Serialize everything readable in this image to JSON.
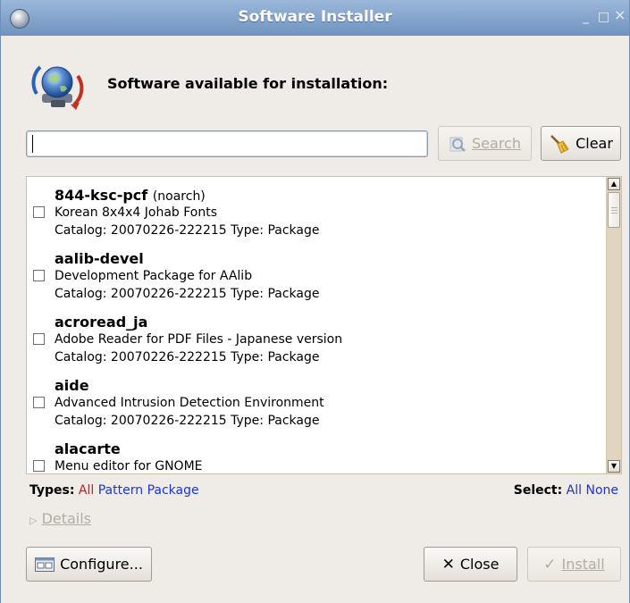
{
  "window": {
    "title": "Software Installer",
    "minimize": "_",
    "maximize": "□",
    "close": "×"
  },
  "header": {
    "text": "Software available for installation:"
  },
  "search": {
    "value": "",
    "placeholder": "",
    "search_label": "Search",
    "clear_label": "Clear"
  },
  "packages": [
    {
      "name": "844-ksc-pcf",
      "arch": "(noarch)",
      "description": "Korean 8x4x4 Johab Fonts",
      "meta": "Catalog: 20070226-222215 Type: Package"
    },
    {
      "name": "aalib-devel",
      "arch": "",
      "description": "Development Package for AAlib",
      "meta": "Catalog: 20070226-222215 Type: Package"
    },
    {
      "name": "acroread_ja",
      "arch": "",
      "description": "Adobe Reader for PDF Files - Japanese version",
      "meta": "Catalog: 20070226-222215 Type: Package"
    },
    {
      "name": "aide",
      "arch": "",
      "description": "Advanced Intrusion Detection Environment",
      "meta": "Catalog: 20070226-222215 Type: Package"
    },
    {
      "name": "alacarte",
      "arch": "",
      "description": "Menu editor for GNOME",
      "meta": ""
    }
  ],
  "types": {
    "label": "Types:",
    "all": "All",
    "pattern": "Pattern",
    "package": "Package"
  },
  "select": {
    "label": "Select:",
    "all": "All",
    "none": "None"
  },
  "details": {
    "label": "Details"
  },
  "buttons": {
    "configure": "Configure...",
    "close": "Close",
    "install": "Install"
  },
  "colors": {
    "titlebar": "#7f9fc8",
    "link_red": "#e01010",
    "link_blue": "#1a35d6"
  }
}
